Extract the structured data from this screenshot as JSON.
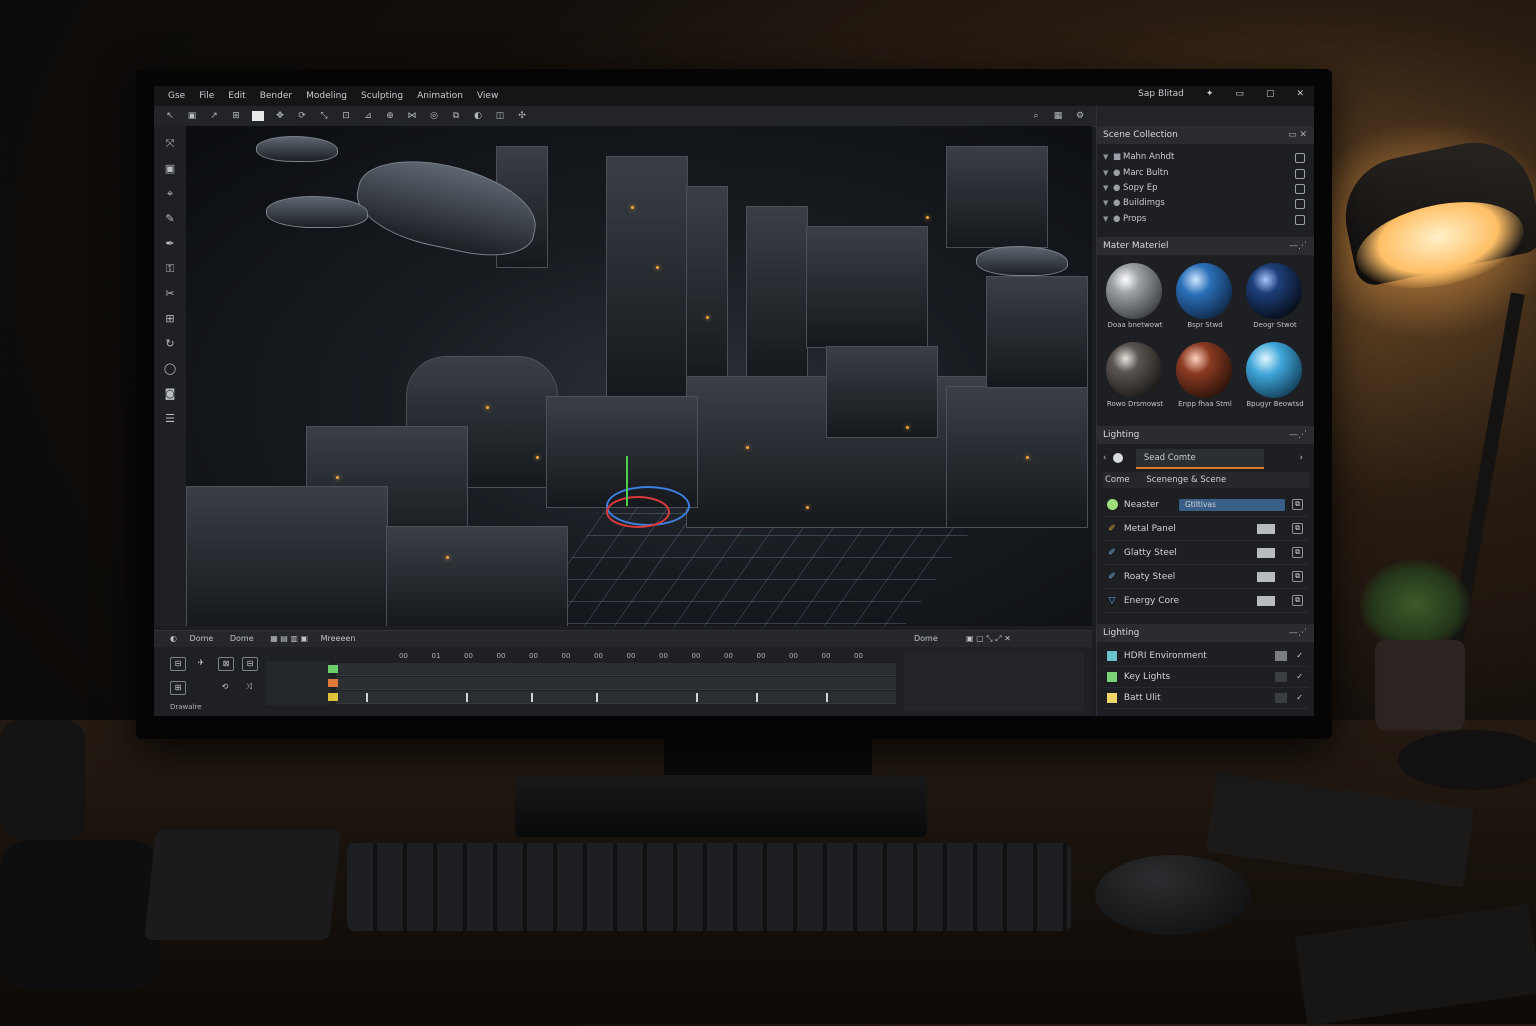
{
  "menubar": {
    "items": [
      "Gse",
      "File",
      "Edit",
      "Bender",
      "Modeling",
      "Sculpting",
      "Animation",
      "View"
    ],
    "right_text": "Sap Blitad"
  },
  "scene_collection": {
    "title": "Scene Collection",
    "items": [
      "Mahn Anhdt",
      "Marc Bultn",
      "Sopy Ep",
      "Buildimgs",
      "Props"
    ]
  },
  "materials": {
    "title": "Mater Materiel",
    "items": [
      {
        "label": "Doaa bnetwowt",
        "color": "#9ea3a8"
      },
      {
        "label": "Bspr Stwd",
        "color": "#2b6fb8"
      },
      {
        "label": "Deogr Stwot",
        "color": "#1d3f7a"
      },
      {
        "label": "Rowo Drsmowst",
        "color": "#5a5552"
      },
      {
        "label": "Enpp fhaa Stml",
        "color": "#8a3a22"
      },
      {
        "label": "Bpugyr Beowtsd",
        "color": "#3fa6d9"
      }
    ]
  },
  "lighting_top": {
    "title": "Lighting",
    "field": "Sead Comte",
    "tab_a": "Come",
    "tab_b": "Scenenge & Scene"
  },
  "material_list": [
    {
      "label": "Neaster",
      "chip": "Gtlltivas",
      "color": "#9ee07a"
    },
    {
      "label": "Metal Panel",
      "icon": "#d8a64a"
    },
    {
      "label": "Glatty Steel",
      "icon": "#6fb7e6"
    },
    {
      "label": "Roaty Steel",
      "icon": "#6fb7e6"
    },
    {
      "label": "Energy Core",
      "icon": "#6fa8e0"
    }
  ],
  "lighting_bottom": {
    "title": "Lighting",
    "items": [
      {
        "label": "HDRI Environment",
        "icon": "#6dc0d0"
      },
      {
        "label": "Key Lights",
        "icon": "#7fd07a"
      },
      {
        "label": "Batt Ulit",
        "icon": "#f0d66a"
      }
    ]
  },
  "timeline": {
    "labels": [
      "Dome",
      "Dome",
      "Mreeeen"
    ],
    "right_label": "Dome",
    "frames": [
      "00",
      "01",
      "00",
      "00",
      "00",
      "00",
      "00",
      "00",
      "00",
      "00",
      "00",
      "00",
      "00",
      "00",
      "00"
    ],
    "bottom_label": "Drawalre"
  }
}
